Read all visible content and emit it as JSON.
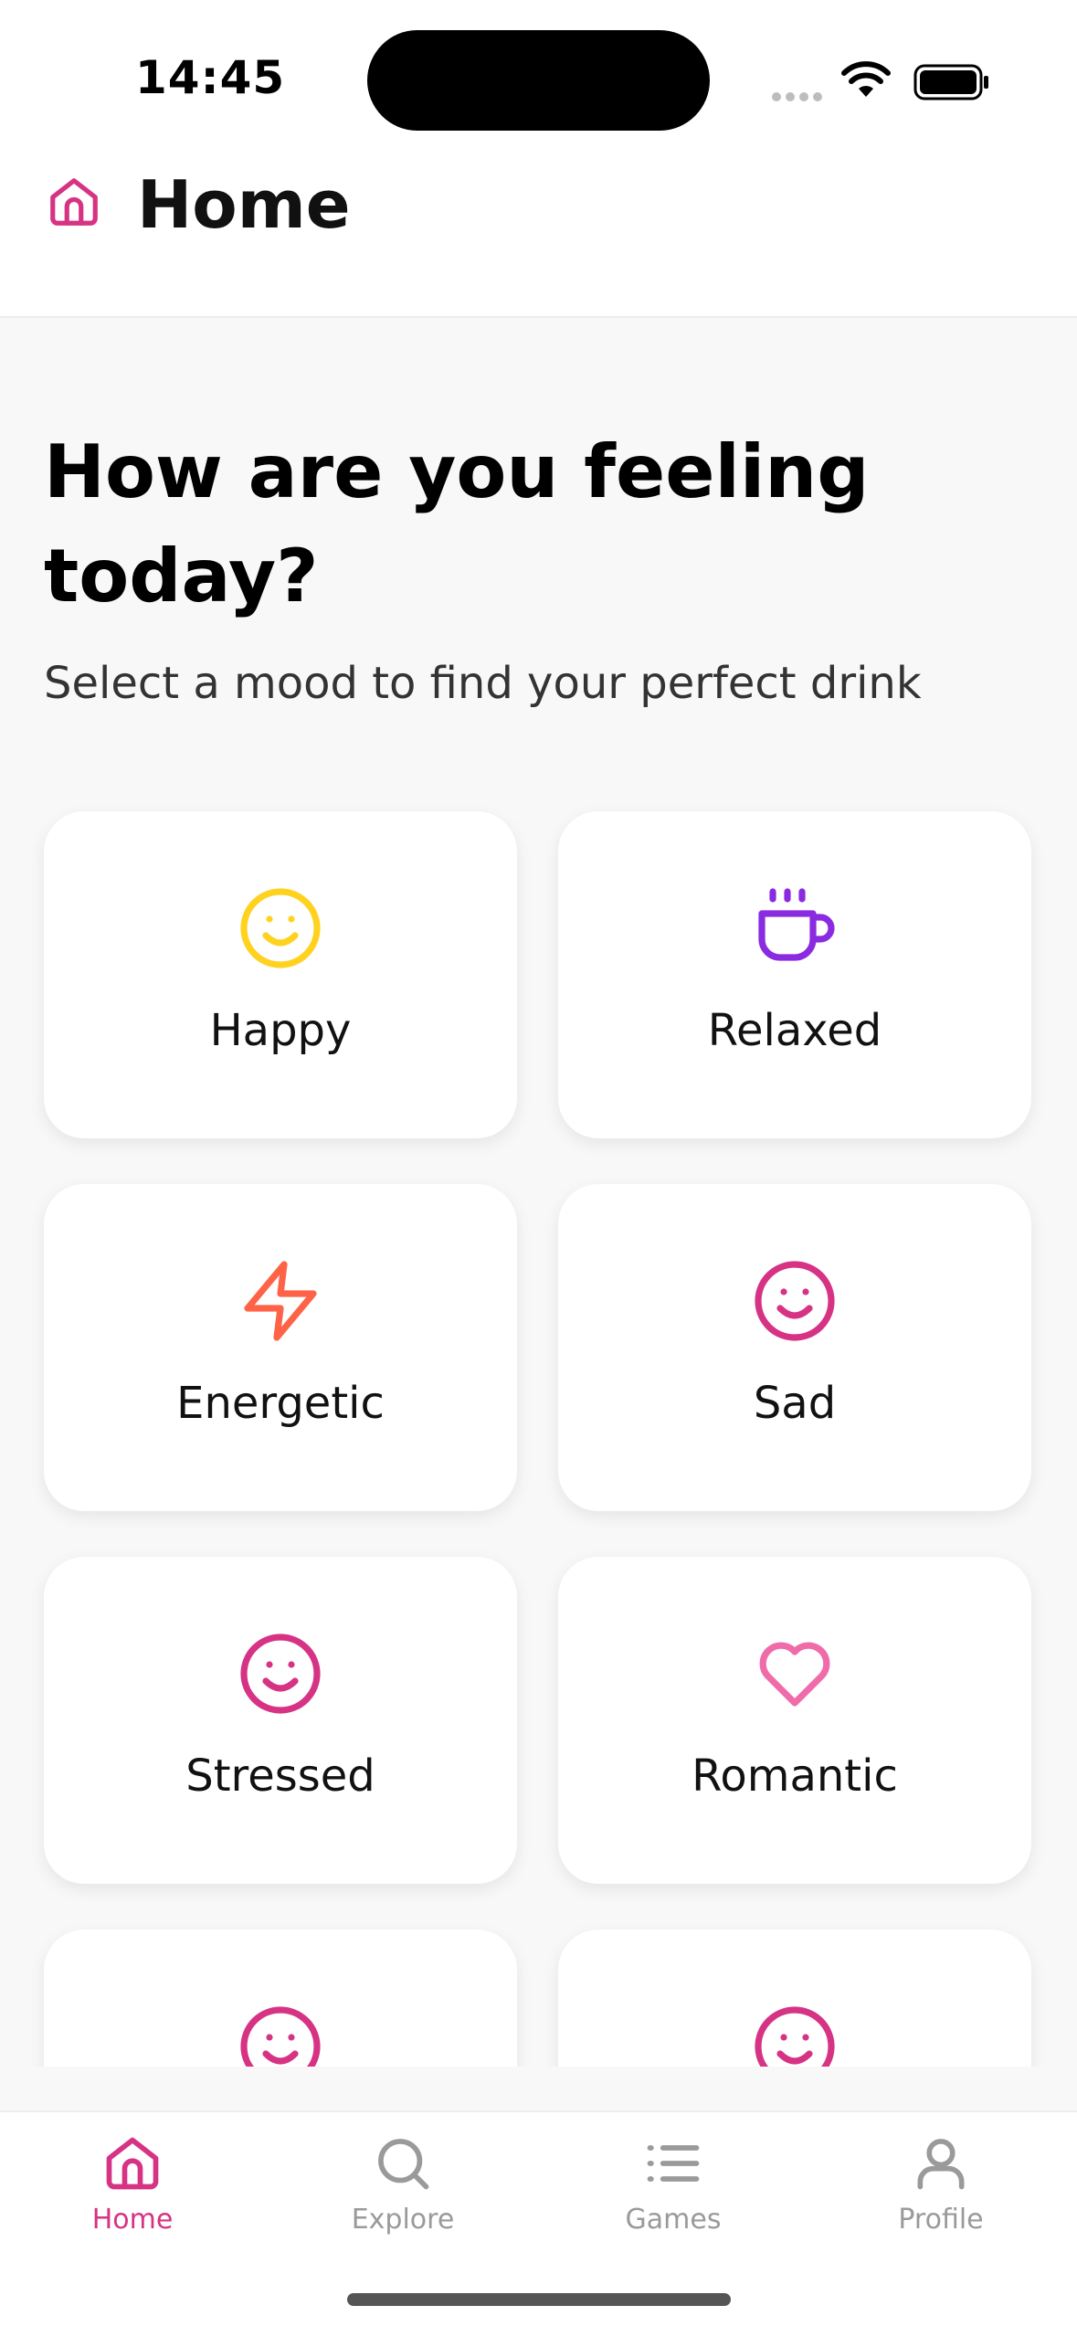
{
  "status_bar": {
    "time": "14:45"
  },
  "header": {
    "title": "Home",
    "icon": "home-icon"
  },
  "main": {
    "headline": "How are you feeling today?",
    "subtitle": "Select a mood to find your perfect drink"
  },
  "moods": [
    {
      "label": "Happy",
      "icon": "smile-icon",
      "color": "#FFD21F"
    },
    {
      "label": "Relaxed",
      "icon": "coffee-cup-icon",
      "color": "#8A2BE2"
    },
    {
      "label": "Energetic",
      "icon": "lightning-icon",
      "color": "#FF6347"
    },
    {
      "label": "Sad",
      "icon": "smile-icon",
      "color": "#D63384"
    },
    {
      "label": "Stressed",
      "icon": "smile-icon",
      "color": "#D63384"
    },
    {
      "label": "Romantic",
      "icon": "heart-icon",
      "color": "#F06BAA"
    },
    {
      "label": "",
      "icon": "smile-icon",
      "color": "#D63384"
    },
    {
      "label": "",
      "icon": "smile-icon",
      "color": "#D63384"
    }
  ],
  "bottom_nav": {
    "items": [
      {
        "label": "Home",
        "icon": "home-icon",
        "active": true
      },
      {
        "label": "Explore",
        "icon": "search-icon",
        "active": false
      },
      {
        "label": "Games",
        "icon": "list-icon",
        "active": false
      },
      {
        "label": "Profile",
        "icon": "person-icon",
        "active": false
      }
    ]
  },
  "colors": {
    "accent": "#D63384",
    "inactive": "#9A9A9A",
    "background": "#F8F8F8"
  }
}
